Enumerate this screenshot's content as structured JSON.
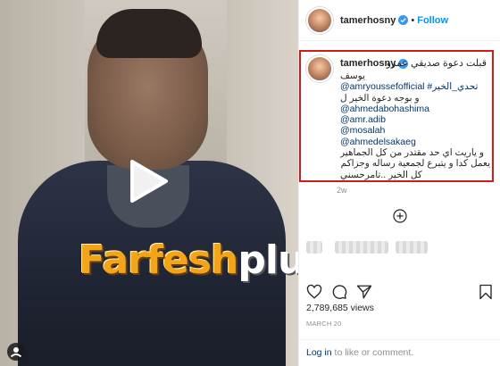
{
  "post": {
    "username": "tamerhosny",
    "follow_label": "Follow",
    "separator": "•",
    "time_ago": "2w",
    "views": "2,789,685 views",
    "date": "MARCH 20"
  },
  "caption": {
    "first_line": "قبلت دعوة صديقي عمرو",
    "lines": [
      {
        "text": "يوسف",
        "rtl": true,
        "link": false
      },
      {
        "text": "@amryoussefofficial #تحدي_الخير",
        "rtl": false,
        "link": true
      },
      {
        "text": "و بوجه دعوة الخير ل",
        "rtl": true,
        "link": false
      },
      {
        "text": "@ahmedabohashima",
        "rtl": false,
        "link": true
      },
      {
        "text": "@amr.adib",
        "rtl": false,
        "link": true
      },
      {
        "text": "@mosalah",
        "rtl": false,
        "link": true
      },
      {
        "text": "@ahmedelsakaeg",
        "rtl": false,
        "link": true
      },
      {
        "text": "و ياريت اي حد مقتدر من كل الجماهير",
        "rtl": true,
        "link": false
      },
      {
        "text": "يعمل كدا و يتبرع لجمعية رساله وجزاكم الله",
        "rtl": true,
        "link": false
      },
      {
        "text": "كل الخير ..تامرحسني",
        "rtl": true,
        "link": false
      }
    ]
  },
  "watermark": {
    "brand": "Farfesh",
    "suffix": "plus.com"
  },
  "footer": {
    "login_link": "Log in",
    "login_rest": " to like or comment."
  },
  "icons": {
    "play": "play-icon",
    "verified": "verified-badge-icon",
    "load_more": "plus-circle-icon",
    "heart": "heart-icon",
    "comment": "comment-icon",
    "share": "share-icon",
    "save": "bookmark-icon"
  },
  "colors": {
    "accent": "#0095f6",
    "highlight_border": "#d11a1a",
    "link": "#00376b",
    "muted": "#8e8e8e",
    "watermark": "#f3a51a"
  }
}
